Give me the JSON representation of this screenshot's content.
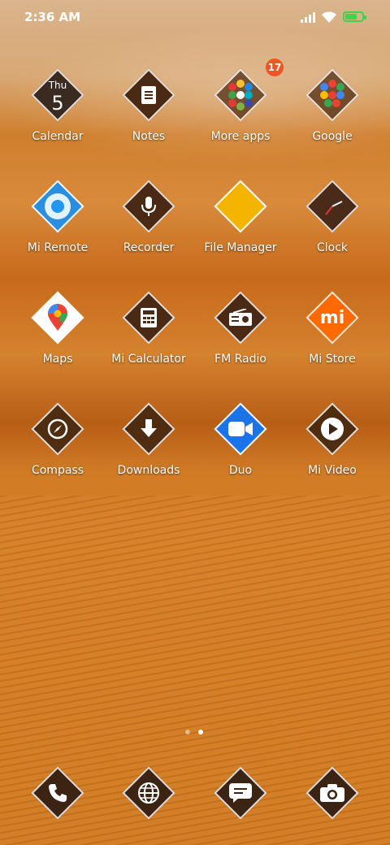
{
  "status_bar": {
    "time": "2:36 AM"
  },
  "home": {
    "rows": [
      [
        {
          "label": "Calendar",
          "icon": "calendar-icon",
          "day_name": "Thu",
          "day_number": "5"
        },
        {
          "label": "Notes",
          "icon": "notes-icon"
        },
        {
          "label": "More apps",
          "icon": "folder-icon",
          "badge": "17"
        },
        {
          "label": "Google",
          "icon": "folder-icon"
        }
      ],
      [
        {
          "label": "Mi Remote",
          "icon": "remote-icon"
        },
        {
          "label": "Recorder",
          "icon": "microphone-icon"
        },
        {
          "label": "File Manager",
          "icon": "folder-icon"
        },
        {
          "label": "Clock",
          "icon": "clock-icon"
        }
      ],
      [
        {
          "label": "Maps",
          "icon": "map-pin-icon"
        },
        {
          "label": "Mi Calculator",
          "icon": "calculator-icon"
        },
        {
          "label": "FM Radio",
          "icon": "radio-icon"
        },
        {
          "label": "Mi Store",
          "icon": "mi-logo-icon",
          "logo_text": "mi"
        }
      ],
      [
        {
          "label": "Compass",
          "icon": "compass-icon"
        },
        {
          "label": "Downloads",
          "icon": "download-icon"
        },
        {
          "label": "Duo",
          "icon": "video-camera-icon"
        },
        {
          "label": "Mi Video",
          "icon": "play-icon"
        }
      ]
    ]
  },
  "page_indicator": {
    "pages": 2,
    "active": 2
  },
  "dock": [
    {
      "icon": "phone-icon"
    },
    {
      "icon": "globe-icon"
    },
    {
      "icon": "message-icon"
    },
    {
      "icon": "camera-icon"
    }
  ],
  "colors": {
    "battery": "#3fd44a",
    "badge": "#f05523",
    "mi_store": "#ff6a00",
    "duo": "#1a73e8",
    "file_manager": "#f4b400",
    "remote": "#2196f3"
  }
}
